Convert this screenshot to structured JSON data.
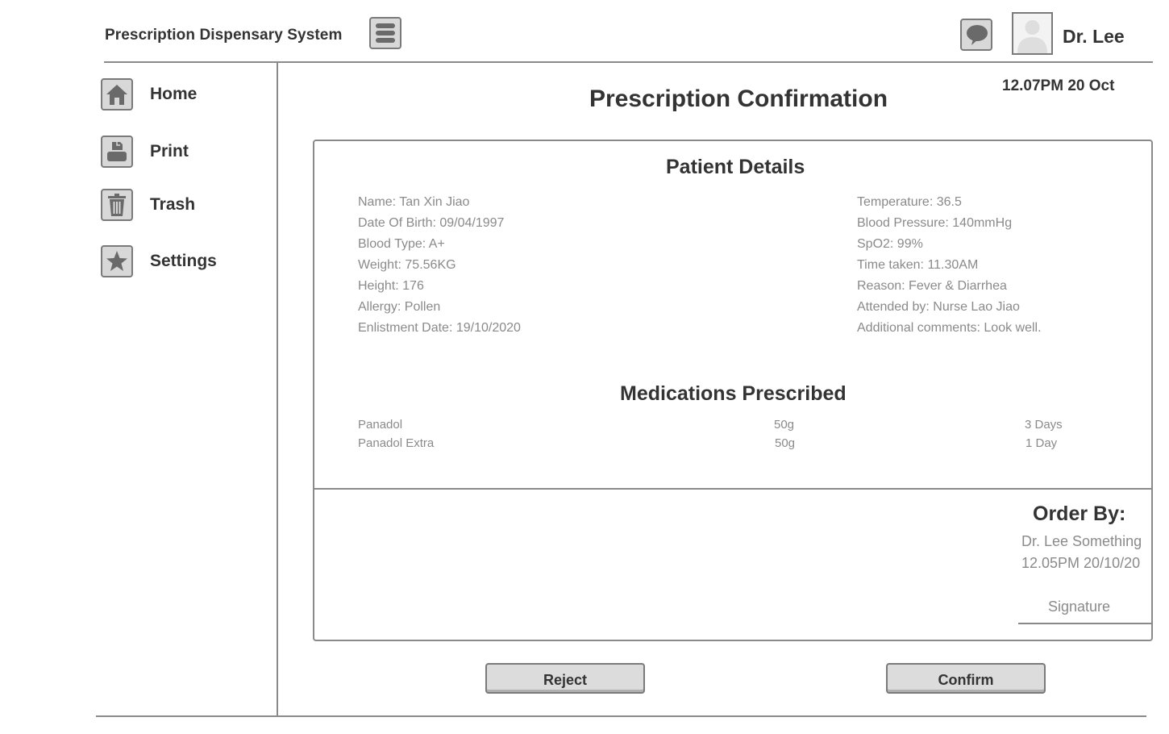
{
  "app": {
    "title": "Prescription Dispensary System",
    "user_name": "Dr. Lee"
  },
  "icons": {
    "menu": "hamburger-menu-icon",
    "chat": "chat-bubble-icon",
    "avatar": "user-avatar-icon",
    "home": "house-icon",
    "print": "printer-icon",
    "trash": "trash-can-icon",
    "settings": "star-icon"
  },
  "sidebar": {
    "items": [
      {
        "label": "Home",
        "icon": "house-icon"
      },
      {
        "label": "Print",
        "icon": "printer-icon"
      },
      {
        "label": "Trash",
        "icon": "trash-can-icon"
      },
      {
        "label": "Settings",
        "icon": "star-icon"
      }
    ]
  },
  "main": {
    "title": "Prescription Confirmation",
    "clock": "12.07PM 20 Oct"
  },
  "patient": {
    "heading": "Patient Details",
    "left": [
      "Name: Tan Xin Jiao",
      "Date Of Birth: 09/04/1997",
      "Blood Type: A+",
      "Weight: 75.56KG",
      "Height: 176",
      "Allergy: Pollen",
      "Enlistment Date: 19/10/2020"
    ],
    "right": [
      "Temperature: 36.5",
      "Blood Pressure: 140mmHg",
      "SpO2: 99%",
      "Time taken: 11.30AM",
      "Reason: Fever & Diarrhea",
      "Attended by: Nurse Lao Jiao",
      "Additional comments: Look well."
    ]
  },
  "medications": {
    "heading": "Medications Prescribed",
    "rows": [
      {
        "name": "Panadol",
        "dose": "50g",
        "duration": "3 Days"
      },
      {
        "name": "Panadol Extra",
        "dose": "50g",
        "duration": "1 Day"
      }
    ]
  },
  "order": {
    "label": "Order By:",
    "doctor": "Dr. Lee Something",
    "timestamp": "12.05PM 20/10/20",
    "signature_label": "Signature"
  },
  "actions": {
    "reject_label": "Reject",
    "confirm_label": "Confirm"
  },
  "colors": {
    "text_dark": "#333333",
    "text_muted": "#8a8a8a",
    "border": "#8a8a8a",
    "button_bg": "#dcdcdc",
    "icon_fill": "#6a6a6a"
  }
}
